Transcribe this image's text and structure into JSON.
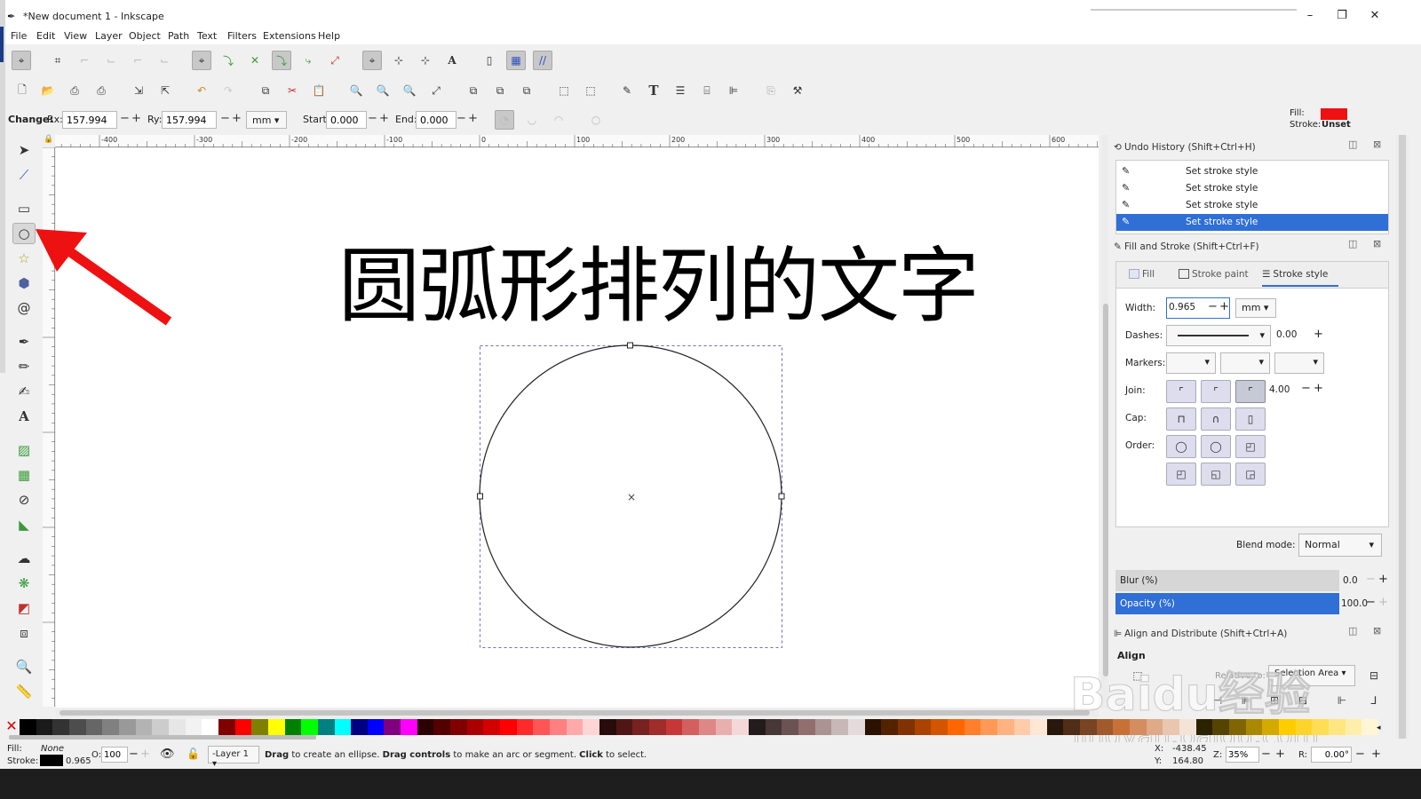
{
  "window": {
    "title": "*New document 1 - Inkscape",
    "minimize": "–",
    "maximize": "❐",
    "close": "✕"
  },
  "menu": [
    "File",
    "Edit",
    "View",
    "Layer",
    "Object",
    "Path",
    "Text",
    "Filters",
    "Extensions",
    "Help"
  ],
  "tool_controls": {
    "change_label": "Change:",
    "rx_label": "Rx:",
    "rx_value": "157.994",
    "ry_label": "Ry:",
    "ry_value": "157.994",
    "unit": "mm",
    "start_label": "Start:",
    "start_value": "0.000",
    "end_label": "End:",
    "end_value": "0.000",
    "minus": "−",
    "plus": "+"
  },
  "style_indicator": {
    "fill_label": "Fill:",
    "fill_color": "#ee1111",
    "stroke_label": "Stroke:",
    "stroke_value": "Unset"
  },
  "ruler_ticks": [
    "-400",
    "-300",
    "-200",
    "-100",
    "0",
    "100",
    "200",
    "300",
    "400",
    "500",
    "600"
  ],
  "canvas": {
    "heading": "圆弧形排列的文字",
    "annotation_color": "#ee1111"
  },
  "undo_history": {
    "title": "Undo History (Shift+Ctrl+H)",
    "items": [
      "Set stroke style",
      "Set stroke style",
      "Set stroke style",
      "Set stroke style"
    ]
  },
  "fill_stroke": {
    "title": "Fill and Stroke (Shift+Ctrl+F)",
    "tabs": [
      "Fill",
      "Stroke paint",
      "Stroke style"
    ],
    "width_label": "Width:",
    "width_value": "0.965",
    "width_unit": "mm",
    "dashes_label": "Dashes:",
    "dashes_value": "0.00",
    "markers_label": "Markers:",
    "join_label": "Join:",
    "join_value": "4.00",
    "cap_label": "Cap:",
    "order_label": "Order:",
    "blend_label": "Blend mode:",
    "blend_value": "Normal",
    "blur_label": "Blur (%)",
    "blur_value": "0.0",
    "opacity_label": "Opacity (%)",
    "opacity_value": "100.0"
  },
  "align": {
    "title": "Align and Distribute (Shift+Ctrl+A)",
    "section": "Align",
    "relative_label": "Relative to:",
    "relative_value": "Selection Area"
  },
  "status": {
    "fill_label": "Fill:",
    "fill_value": "None",
    "stroke_label": "Stroke:",
    "stroke_width": "0.965",
    "opacity_label": "O:",
    "opacity_value": "100",
    "layer": "-Layer 1",
    "message_drag": "Drag",
    "message_1": " to create an ellipse. ",
    "message_controls": "Drag controls",
    "message_2": " to make an arc or segment. ",
    "message_click": "Click",
    "message_3": " to select.",
    "x_label": "X:",
    "x_value": "-438.45",
    "y_label": "Y:",
    "y_value": "164.80",
    "zoom_label": "Z:",
    "zoom_value": "35%",
    "rotate_label": "R:",
    "rotate_value": "0.00°"
  },
  "watermark": {
    "logo": "Baidu经验",
    "url": "jingyan.baidu.com"
  },
  "palette_colors": [
    "#000000",
    "#1a1a1a",
    "#333333",
    "#4d4d4d",
    "#666666",
    "#808080",
    "#999999",
    "#b3b3b3",
    "#cccccc",
    "#e6e6e6",
    "#f2f2f2",
    "#ffffff",
    "#800000",
    "#ff0000",
    "#808000",
    "#ffff00",
    "#008000",
    "#00ff00",
    "#008080",
    "#00ffff",
    "#000080",
    "#0000ff",
    "#800080",
    "#ff00ff",
    "#2b0000",
    "#550000",
    "#800000",
    "#aa0000",
    "#d40000",
    "#ff0000",
    "#ff2a2a",
    "#ff5555",
    "#ff8080",
    "#ffaaaa",
    "#ffd5d5",
    "#280b0b",
    "#501616",
    "#782121",
    "#a02c2c",
    "#c83737",
    "#d35f5f",
    "#de8787",
    "#e9afaf",
    "#f4d7d7",
    "#241c1c",
    "#483737",
    "#6c5353",
    "#916f6f",
    "#ac9393",
    "#c8b7b7",
    "#e3dbdb",
    "#2b1100",
    "#552200",
    "#803300",
    "#aa4400",
    "#d45500",
    "#ff6600",
    "#ff7f2a",
    "#ff9955",
    "#ffb380",
    "#ffccaa",
    "#ffe6d5",
    "#28170b",
    "#502d16",
    "#784421",
    "#a05a2c",
    "#c87137",
    "#d38d5f",
    "#deaa87",
    "#e9c6af",
    "#f4e3d7",
    "#2b2200",
    "#554400",
    "#806600",
    "#aa8800",
    "#d4aa00",
    "#ffcc00",
    "#ffd42a",
    "#ffdd55",
    "#ffe680",
    "#ffeeaa",
    "#fff6d5"
  ]
}
